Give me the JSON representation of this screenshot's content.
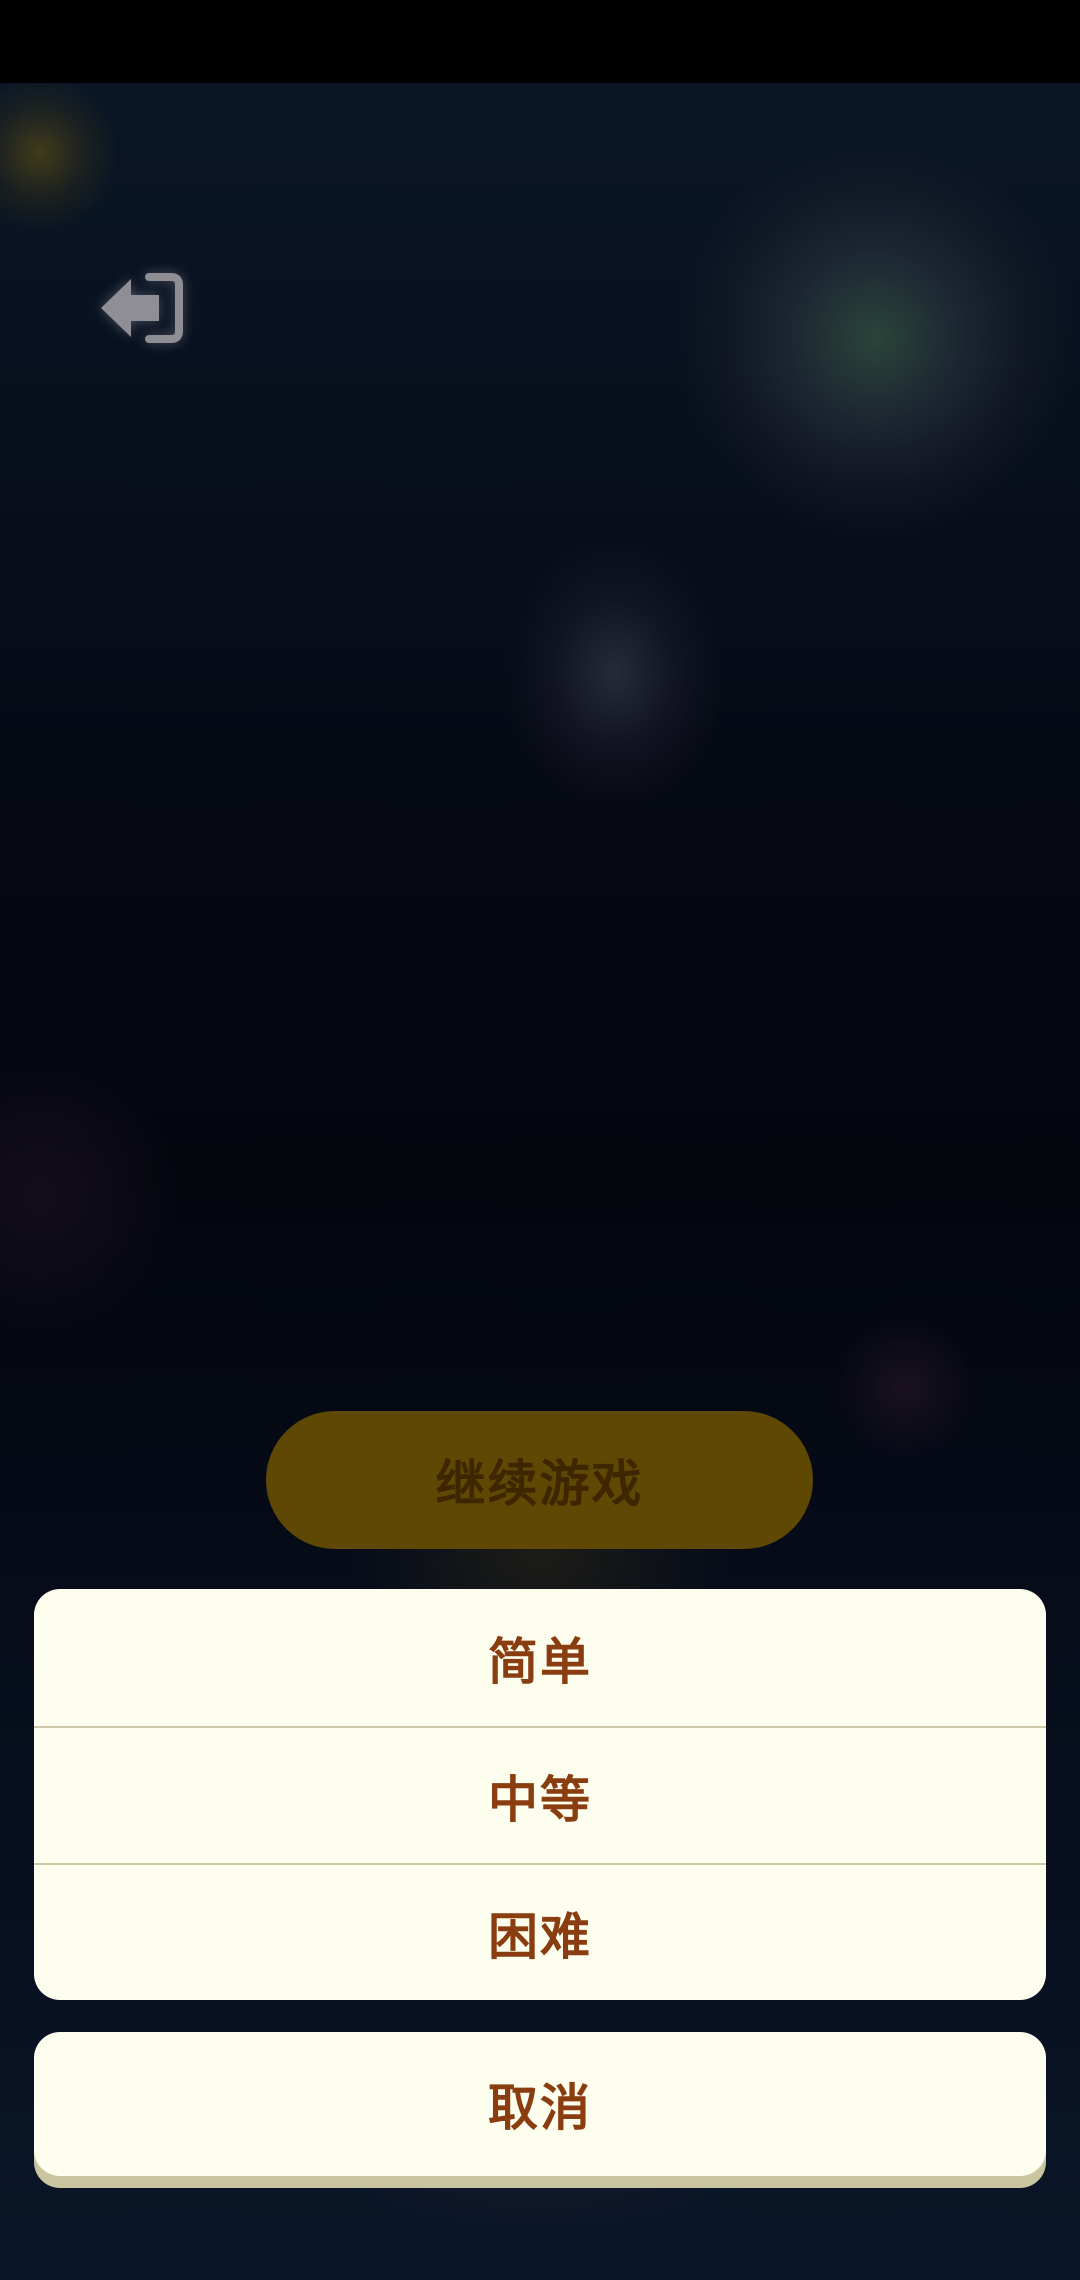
{
  "app": {
    "back_icon": "exit-arrow-icon"
  },
  "main": {
    "continue_label": "继续游戏"
  },
  "difficulty_sheet": {
    "options": [
      {
        "label": "简单"
      },
      {
        "label": "中等"
      },
      {
        "label": "困难"
      }
    ],
    "cancel_label": "取消"
  },
  "colors": {
    "sheet_bg": "#fefeef",
    "sheet_text": "#8a3d10",
    "continue_bg": "#5f4804",
    "continue_text": "#3d2600"
  }
}
